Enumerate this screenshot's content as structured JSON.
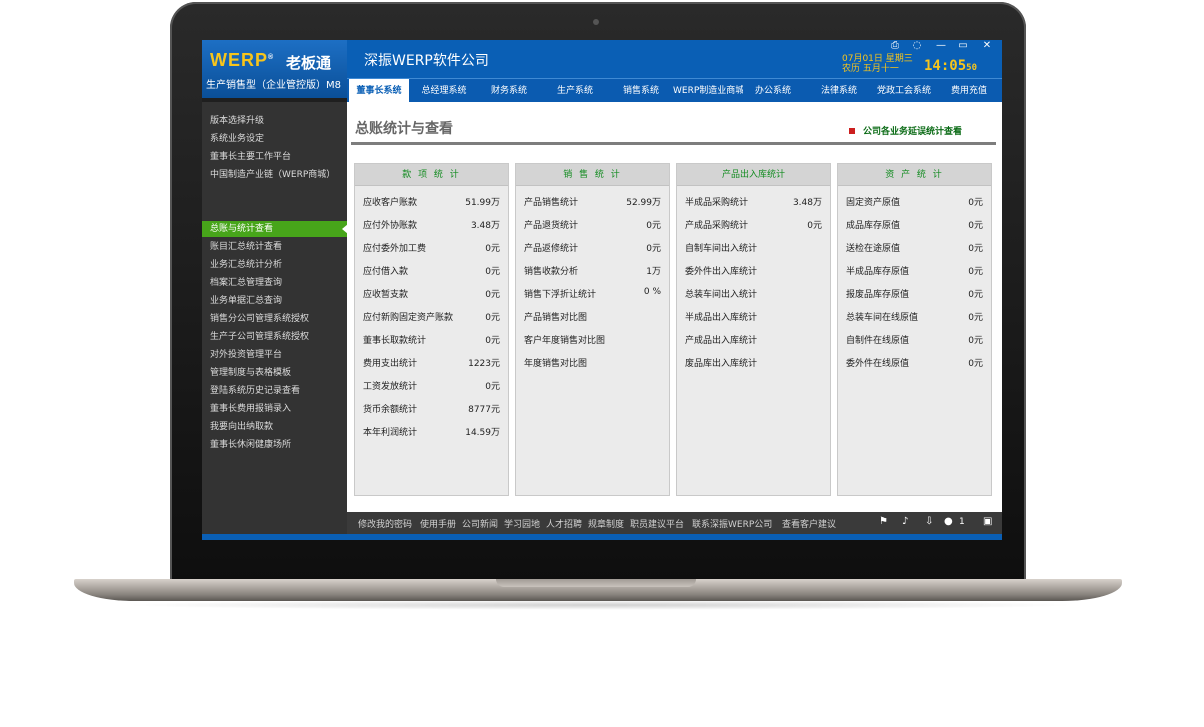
{
  "header": {
    "logo_text": "WERP",
    "logo_reg": "®",
    "logo_cn": "老板通",
    "edition": "生产销售型（企业管控版）M8",
    "company": "深振WERP软件公司",
    "date_line1": "07月01日 星期三",
    "date_line2": "农历 五月十一",
    "time": "14:05",
    "time_sec": "50",
    "window_controls": [
      "print-icon",
      "chat-icon",
      "minimize-icon",
      "restore-icon",
      "close-icon"
    ]
  },
  "tabs": [
    {
      "label": "董事长系统",
      "active": true
    },
    {
      "label": "总经理系统"
    },
    {
      "label": "财务系统"
    },
    {
      "label": "生产系统"
    },
    {
      "label": "销售系统"
    },
    {
      "label": "WERP制造业商城"
    },
    {
      "label": "办公系统"
    },
    {
      "label": "法律系统"
    },
    {
      "label": "党政工会系统"
    },
    {
      "label": "费用充值"
    }
  ],
  "sidebar": {
    "items": [
      {
        "label": "版本选择升级"
      },
      {
        "label": "系统业务设定"
      },
      {
        "label": "董事长主要工作平台"
      },
      {
        "label": "中国制造产业链（WERP商城）"
      },
      {
        "label": "总账与统计查看",
        "active": true
      },
      {
        "label": "账目汇总统计查看"
      },
      {
        "label": "业务汇总统计分析"
      },
      {
        "label": "档案汇总管理查询"
      },
      {
        "label": "业务单据汇总查询"
      },
      {
        "label": "销售分公司管理系统授权"
      },
      {
        "label": "生产子公司管理系统授权"
      },
      {
        "label": "对外投资管理平台"
      },
      {
        "label": "管理制度与表格模板"
      },
      {
        "label": "登陆系统历史记录查看"
      },
      {
        "label": "董事长费用报销录入"
      },
      {
        "label": "我要向出纳取款"
      },
      {
        "label": "董事长休闲健康场所"
      }
    ]
  },
  "main": {
    "title": "总账统计与查看",
    "alert_link": "公司各业务延误统计查看",
    "panels": [
      {
        "title": "款 项 统 计",
        "rows": [
          {
            "label": "应收客户账款",
            "value": "51.99万"
          },
          {
            "label": "应付外协账款",
            "value": "3.48万"
          },
          {
            "label": "应付委外加工费",
            "value": "0元"
          },
          {
            "label": "应付借入款",
            "value": "0元"
          },
          {
            "label": "应收暂支款",
            "value": "0元"
          },
          {
            "label": "应付新购固定资产账款",
            "value": "0元"
          },
          {
            "label": "董事长取款统计",
            "value": "0元"
          },
          {
            "label": "费用支出统计",
            "value": "1223元"
          },
          {
            "label": "工资发放统计",
            "value": "0元"
          },
          {
            "label": "货币余额统计",
            "value": "8777元"
          },
          {
            "label": "本年利润统计",
            "value": "14.59万"
          }
        ]
      },
      {
        "title": "销 售 统 计",
        "rows": [
          {
            "label": "产品销售统计",
            "value": "52.99万"
          },
          {
            "label": "产品退货统计",
            "value": "0元"
          },
          {
            "label": "产品返修统计",
            "value": "0元"
          },
          {
            "label": "销售收款分析",
            "value": "1万"
          },
          {
            "label": "销售下浮折让统计",
            "value": "0 %"
          },
          {
            "label": "产品销售对比图",
            "value": ""
          },
          {
            "label": "客户年度销售对比图",
            "value": ""
          },
          {
            "label": "年度销售对比图",
            "value": ""
          }
        ]
      },
      {
        "title": "产品出入库统计",
        "rows": [
          {
            "label": "半成品采购统计",
            "value": "3.48万"
          },
          {
            "label": "产成品采购统计",
            "value": "0元"
          },
          {
            "label": "自制车间出入统计",
            "value": ""
          },
          {
            "label": "委外件出入库统计",
            "value": ""
          },
          {
            "label": "总装车间出入统计",
            "value": ""
          },
          {
            "label": "半成品出入库统计",
            "value": ""
          },
          {
            "label": "产成品出入库统计",
            "value": ""
          },
          {
            "label": "废品库出入库统计",
            "value": ""
          }
        ]
      },
      {
        "title": "资 产 统 计",
        "rows": [
          {
            "label": "固定资产原值",
            "value": "0元"
          },
          {
            "label": "成品库存原值",
            "value": "0元"
          },
          {
            "label": "送检在途原值",
            "value": "0元"
          },
          {
            "label": "半成品库存原值",
            "value": "0元"
          },
          {
            "label": "报废品库存原值",
            "value": "0元"
          },
          {
            "label": "总装车间在线原值",
            "value": "0元"
          },
          {
            "label": "自制件在线原值",
            "value": "0元"
          },
          {
            "label": "委外件在线原值",
            "value": "0元"
          }
        ]
      }
    ]
  },
  "footer": {
    "links": [
      {
        "label": "修改我的密码"
      },
      {
        "label": "使用手册"
      },
      {
        "label": "公司新闻"
      },
      {
        "label": "学习园地"
      },
      {
        "label": "人才招聘"
      },
      {
        "label": "规章制度"
      },
      {
        "label": "职员建议平台"
      },
      {
        "label": "联系深振WERP公司"
      },
      {
        "label": "查看客户建议"
      }
    ],
    "message_count": "1",
    "icons": [
      "flag-icon",
      "speaker-icon",
      "download-icon",
      "message-icon",
      "logout-icon"
    ]
  },
  "colors": {
    "header_blue": "#0a5fb5",
    "active_green": "#47a51a",
    "sidebar_bg": "#333333",
    "panel_title_green": "#138c21",
    "logo_yellow": "#f7c51b",
    "alert_red": "#cc1f1f"
  }
}
